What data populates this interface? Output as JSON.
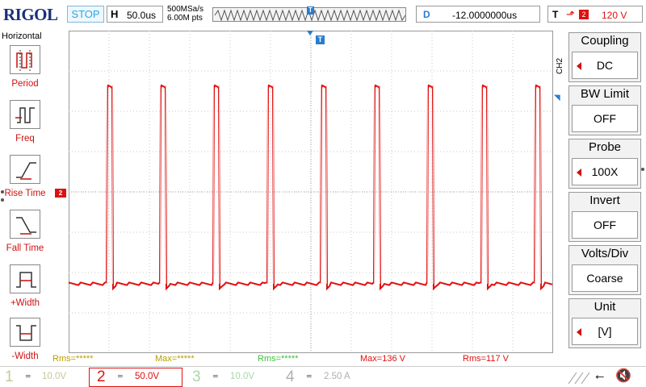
{
  "header": {
    "brand": "RIGOL",
    "run_state": "STOP",
    "horizontal_label": "H",
    "timebase": "50.0us",
    "sample_rate": "500MSa/s",
    "memory_depth": "6.00M pts",
    "memory_marker": "T",
    "delay_label": "D",
    "delay_value": "-12.0000000us",
    "trigger_label": "T",
    "trigger_source": "2",
    "trigger_level": "120 V"
  },
  "left_menu": {
    "title": "Horizontal",
    "items": [
      {
        "label": "Period",
        "icon": "period-icon"
      },
      {
        "label": "Freq",
        "icon": "frequency-icon"
      },
      {
        "label": "Rise Time",
        "icon": "rise-time-icon"
      },
      {
        "label": "Fall Time",
        "icon": "fall-time-icon"
      },
      {
        "label": "+Width",
        "icon": "positive-width-icon"
      },
      {
        "label": "-Width",
        "icon": "negative-width-icon"
      }
    ]
  },
  "display": {
    "trigger_position_marker": "T",
    "ch2_marker": "2",
    "trace_color": "#e01010",
    "grid_color": "#c8c8c8"
  },
  "right_menu": {
    "channel_tag": "CH2",
    "items": [
      {
        "title": "Coupling",
        "value": "DC"
      },
      {
        "title": "BW Limit",
        "value": "OFF"
      },
      {
        "title": "Probe",
        "value": "100X"
      },
      {
        "title": "Invert",
        "value": "OFF"
      },
      {
        "title": "Volts/Div",
        "value": "Coarse"
      },
      {
        "title": "Unit",
        "value": "[V]"
      }
    ]
  },
  "measurements": [
    {
      "text": "Rms=*****",
      "color": "#b8a000"
    },
    {
      "text": "Max=*****",
      "color": "#b8a000"
    },
    {
      "text": "Rms=*****",
      "color": "#3cc03c"
    },
    {
      "text": "Max=136 V",
      "color": "#e01010"
    },
    {
      "text": "Rms=117 V",
      "color": "#e01010"
    }
  ],
  "channels": [
    {
      "number": "1",
      "scale": "10.0V",
      "color": "#c8c89a"
    },
    {
      "number": "2",
      "scale": "50.0V",
      "color": "#e01010"
    },
    {
      "number": "3",
      "scale": "10.0V",
      "color": "#a8d8a8"
    },
    {
      "number": "4",
      "scale": "2.50 A",
      "color": "#b0b0b0"
    }
  ],
  "status_icons": [
    "usb-icon",
    "speaker-muted-icon"
  ]
}
